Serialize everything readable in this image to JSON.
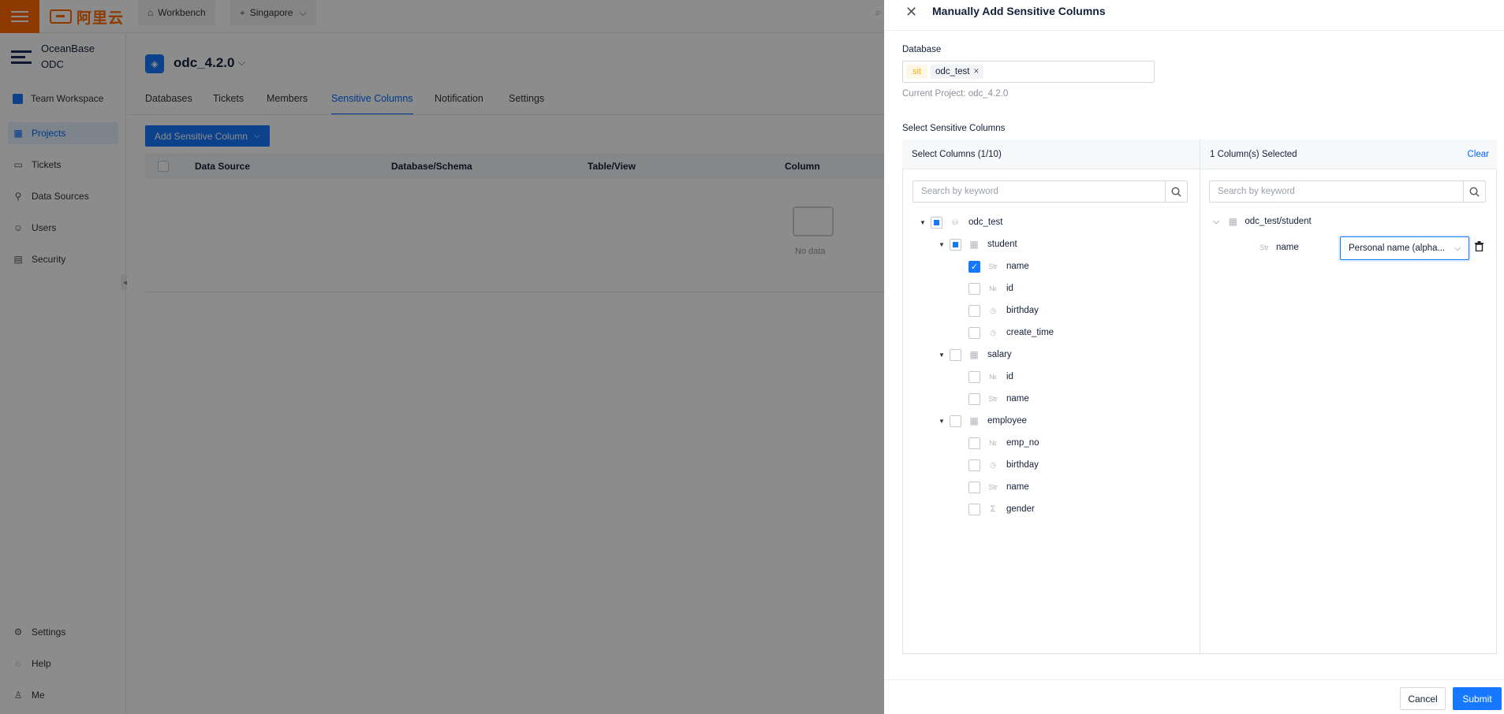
{
  "topbar": {
    "logo_text": "阿里云",
    "workbench_label": "Workbench",
    "region_label": "Singapore"
  },
  "sidebar": {
    "brand_line1": "OceanBase",
    "brand_line2": "ODC",
    "workspace": "Team Workspace",
    "items": [
      {
        "label": "Projects",
        "icon": "projects-icon"
      },
      {
        "label": "Tickets",
        "icon": "tickets-icon"
      },
      {
        "label": "Data Sources",
        "icon": "data-sources-icon"
      },
      {
        "label": "Users",
        "icon": "users-icon"
      },
      {
        "label": "Security",
        "icon": "security-icon"
      }
    ],
    "bottom": [
      {
        "label": "Settings",
        "icon": "gear-icon"
      },
      {
        "label": "Help",
        "icon": "bulb-icon"
      },
      {
        "label": "Me",
        "icon": "user-icon"
      }
    ]
  },
  "project": {
    "title": "odc_4.2.0",
    "tabs": [
      "Databases",
      "Tickets",
      "Members",
      "Sensitive Columns",
      "Notification",
      "Settings"
    ],
    "active_tab": "Sensitive Columns",
    "add_button": "Add Sensitive Column",
    "columns": [
      "Data Source",
      "Database/Schema",
      "Table/View",
      "Column"
    ],
    "empty_text": "No data"
  },
  "drawer": {
    "title": "Manually Add Sensitive Columns",
    "database_label": "Database",
    "env_tag": "sit",
    "db_tag": "odc_test",
    "current_project": "Current Project: odc_4.2.0",
    "select_label": "Select Sensitive Columns",
    "left_header": "Select Columns (1/10)",
    "right_header": "1 Column(s) Selected",
    "clear_label": "Clear",
    "search_placeholder": "Search by keyword",
    "tree": {
      "database": "odc_test",
      "tables": [
        {
          "name": "student",
          "state": "indeterminate",
          "columns": [
            {
              "name": "name",
              "type": "string",
              "checked": true
            },
            {
              "name": "id",
              "type": "number",
              "checked": false
            },
            {
              "name": "birthday",
              "type": "time",
              "checked": false
            },
            {
              "name": "create_time",
              "type": "time",
              "checked": false
            }
          ]
        },
        {
          "name": "salary",
          "state": "unchecked",
          "columns": [
            {
              "name": "id",
              "type": "number",
              "checked": false
            },
            {
              "name": "name",
              "type": "string",
              "checked": false
            }
          ]
        },
        {
          "name": "employee",
          "state": "unchecked",
          "columns": [
            {
              "name": "emp_no",
              "type": "number",
              "checked": false
            },
            {
              "name": "birthday",
              "type": "time",
              "checked": false
            },
            {
              "name": "name",
              "type": "string",
              "checked": false
            },
            {
              "name": "gender",
              "type": "enum",
              "checked": false
            }
          ]
        }
      ]
    },
    "selected": {
      "group": "odc_test/student",
      "column": "name",
      "masking_value": "Personal name (alpha..."
    },
    "cancel_label": "Cancel",
    "submit_label": "Submit"
  }
}
